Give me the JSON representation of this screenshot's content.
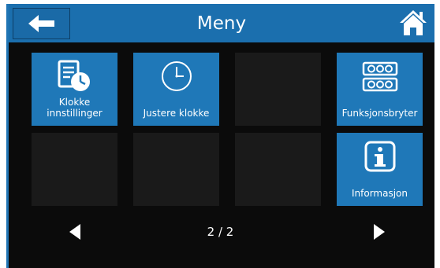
{
  "header": {
    "title": "Meny",
    "back_icon": "arrow-left-icon",
    "home_icon": "home-icon"
  },
  "tiles": [
    {
      "label": "Klokke\ninnstillinger",
      "icon": "clock-settings-icon",
      "active": true
    },
    {
      "label": "Justere klokke",
      "icon": "clock-icon",
      "active": true
    },
    {
      "label": "",
      "active": false
    },
    {
      "label": "Funksjonsbryter",
      "icon": "function-switch-icon",
      "active": true
    },
    {
      "label": "",
      "active": false
    },
    {
      "label": "",
      "active": false
    },
    {
      "label": "",
      "active": false
    },
    {
      "label": "Informasjon",
      "icon": "info-icon",
      "active": true
    }
  ],
  "pager": {
    "current": "2 / 2",
    "prev_icon": "triangle-left-icon",
    "next_icon": "triangle-right-icon"
  },
  "colors": {
    "header": "#1b6fae",
    "tile_active": "#1f78b8",
    "tile_empty": "#1a1a1a",
    "background": "#0b0b0b"
  }
}
